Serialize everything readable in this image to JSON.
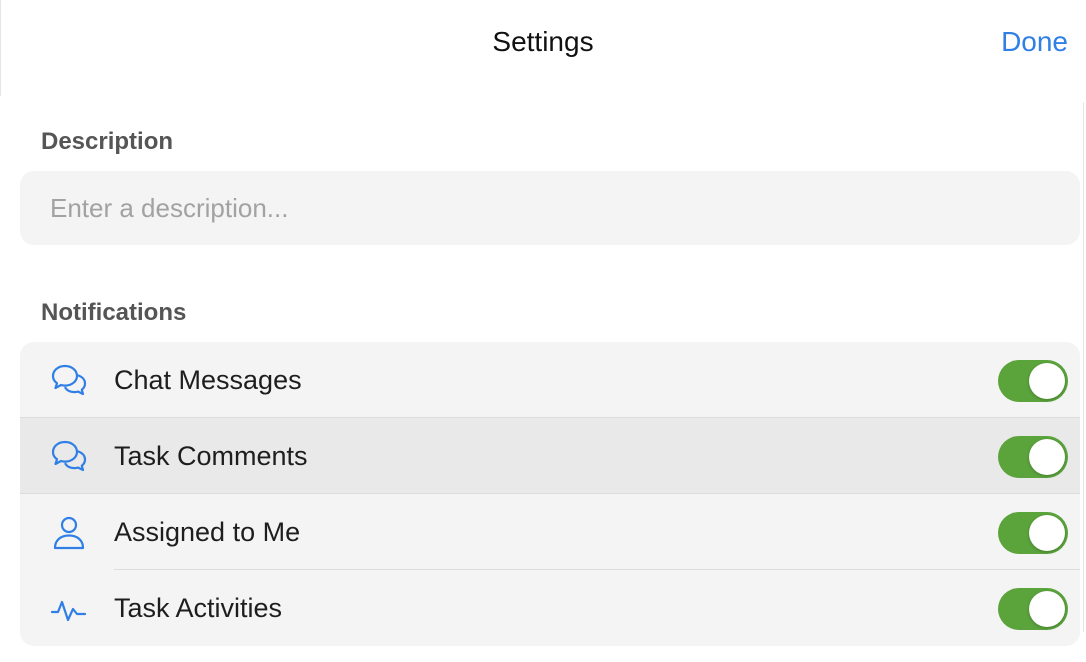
{
  "nav": {
    "title": "Settings",
    "done_label": "Done"
  },
  "description": {
    "header": "Description",
    "placeholder": "Enter a description...",
    "value": ""
  },
  "notifications": {
    "header": "Notifications",
    "items": [
      {
        "label": "Chat Messages",
        "icon": "chat-bubbles-icon",
        "enabled": true
      },
      {
        "label": "Task Comments",
        "icon": "chat-bubbles-icon",
        "enabled": true
      },
      {
        "label": "Assigned to Me",
        "icon": "person-icon",
        "enabled": true
      },
      {
        "label": "Task Activities",
        "icon": "activity-pulse-icon",
        "enabled": true
      }
    ]
  },
  "colors": {
    "accent": "#2f7fe6",
    "toggle_on": "#5ba43c",
    "group_background": "#f4f4f4",
    "selected_row": "#e9e9e9"
  }
}
